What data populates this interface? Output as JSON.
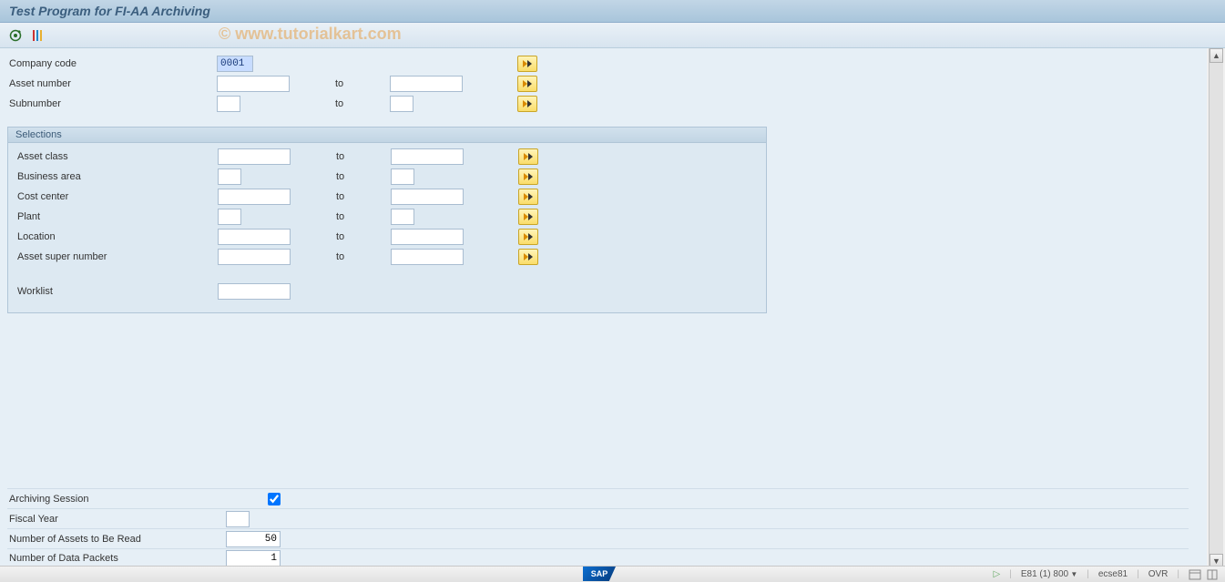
{
  "title": "Test Program for FI-AA Archiving",
  "watermark": "© www.tutorialkart.com",
  "top": {
    "company_code_label": "Company code",
    "company_code_value": "0001",
    "asset_number_label": "Asset number",
    "subnumber_label": "Subnumber",
    "to_label": "to"
  },
  "selections": {
    "header": "Selections",
    "asset_class_label": "Asset class",
    "business_area_label": "Business area",
    "cost_center_label": "Cost center",
    "plant_label": "Plant",
    "location_label": "Location",
    "asset_super_label": "Asset super number",
    "worklist_label": "Worklist",
    "to_label": "to"
  },
  "bottom": {
    "archiving_session_label": "Archiving Session",
    "archiving_session_checked": true,
    "fiscal_year_label": "Fiscal Year",
    "assets_read_label": "Number of Assets to Be Read",
    "assets_read_value": "50",
    "data_packets_label": "Number of Data Packets",
    "data_packets_value": "1"
  },
  "statusbar": {
    "sap": "SAP",
    "session": "E81 (1) 800",
    "server": "ecse81",
    "mode": "OVR"
  }
}
